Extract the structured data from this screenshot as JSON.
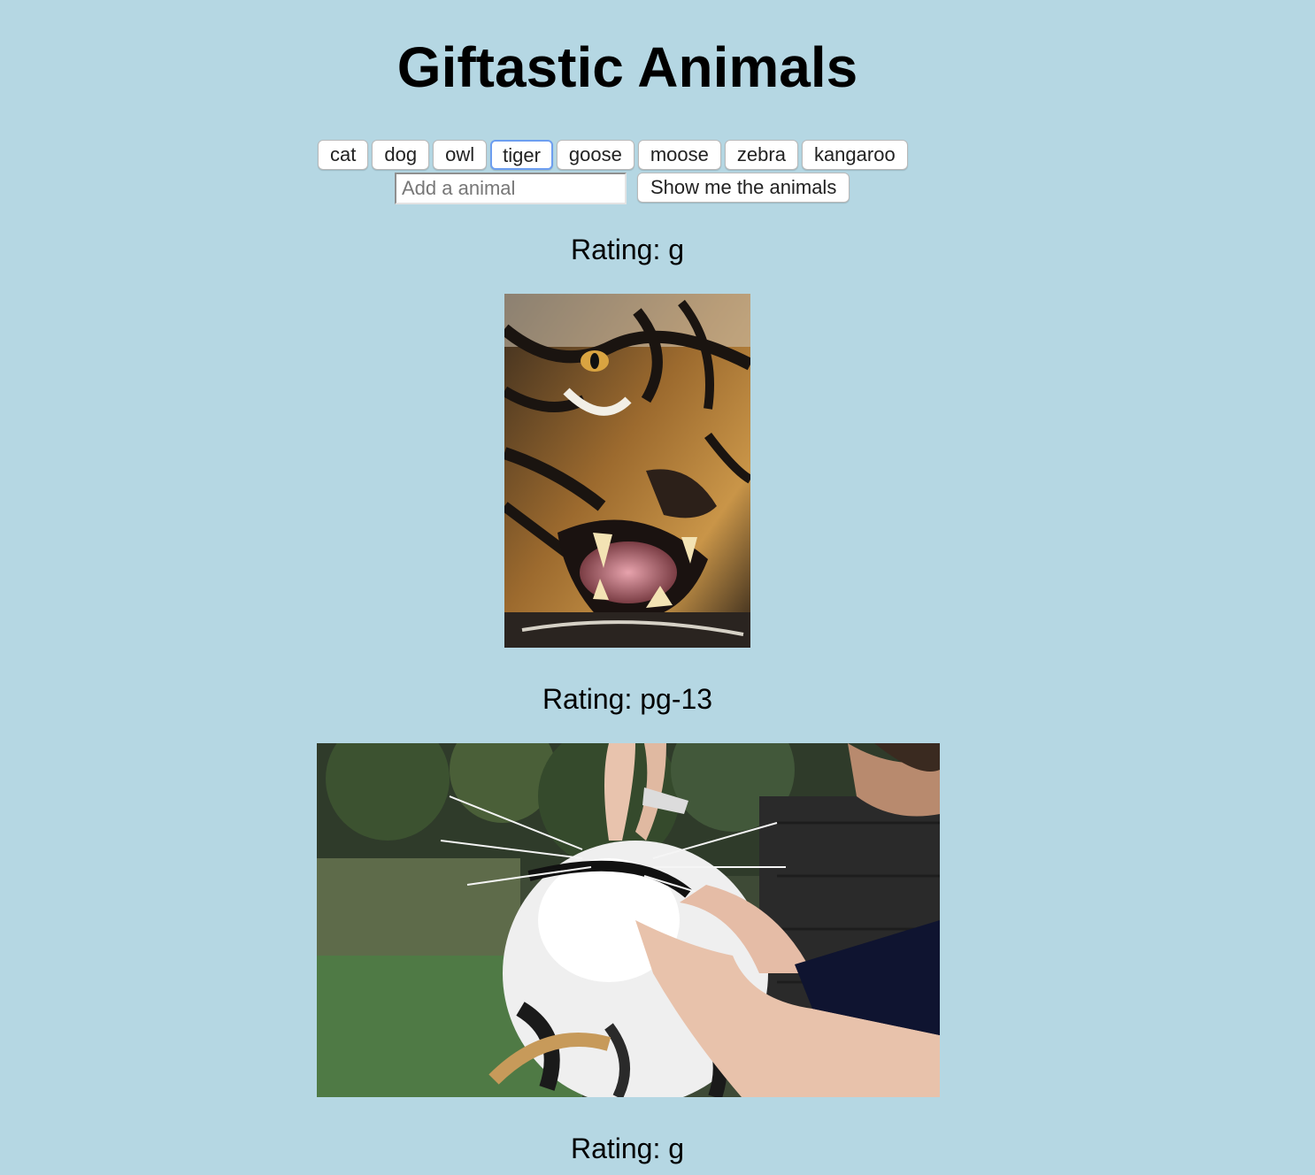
{
  "header": {
    "title": "Giftastic Animals"
  },
  "animal_buttons": [
    {
      "label": "cat"
    },
    {
      "label": "dog"
    },
    {
      "label": "owl"
    },
    {
      "label": "tiger",
      "focused": true
    },
    {
      "label": "goose"
    },
    {
      "label": "moose"
    },
    {
      "label": "zebra"
    },
    {
      "label": "kangaroo"
    }
  ],
  "add_form": {
    "input_value": "",
    "input_placeholder": "Add a animal",
    "submit_label": "Show me the animals"
  },
  "results": [
    {
      "rating": "Rating: g",
      "image": "tiger-snarling-gif"
    },
    {
      "rating": "Rating: pg-13",
      "image": "tiger-teeth-check-gif"
    },
    {
      "rating": "Rating: g"
    }
  ],
  "colors": {
    "background": "#b5d7e3",
    "focus_ring": "#6d9ef0"
  }
}
